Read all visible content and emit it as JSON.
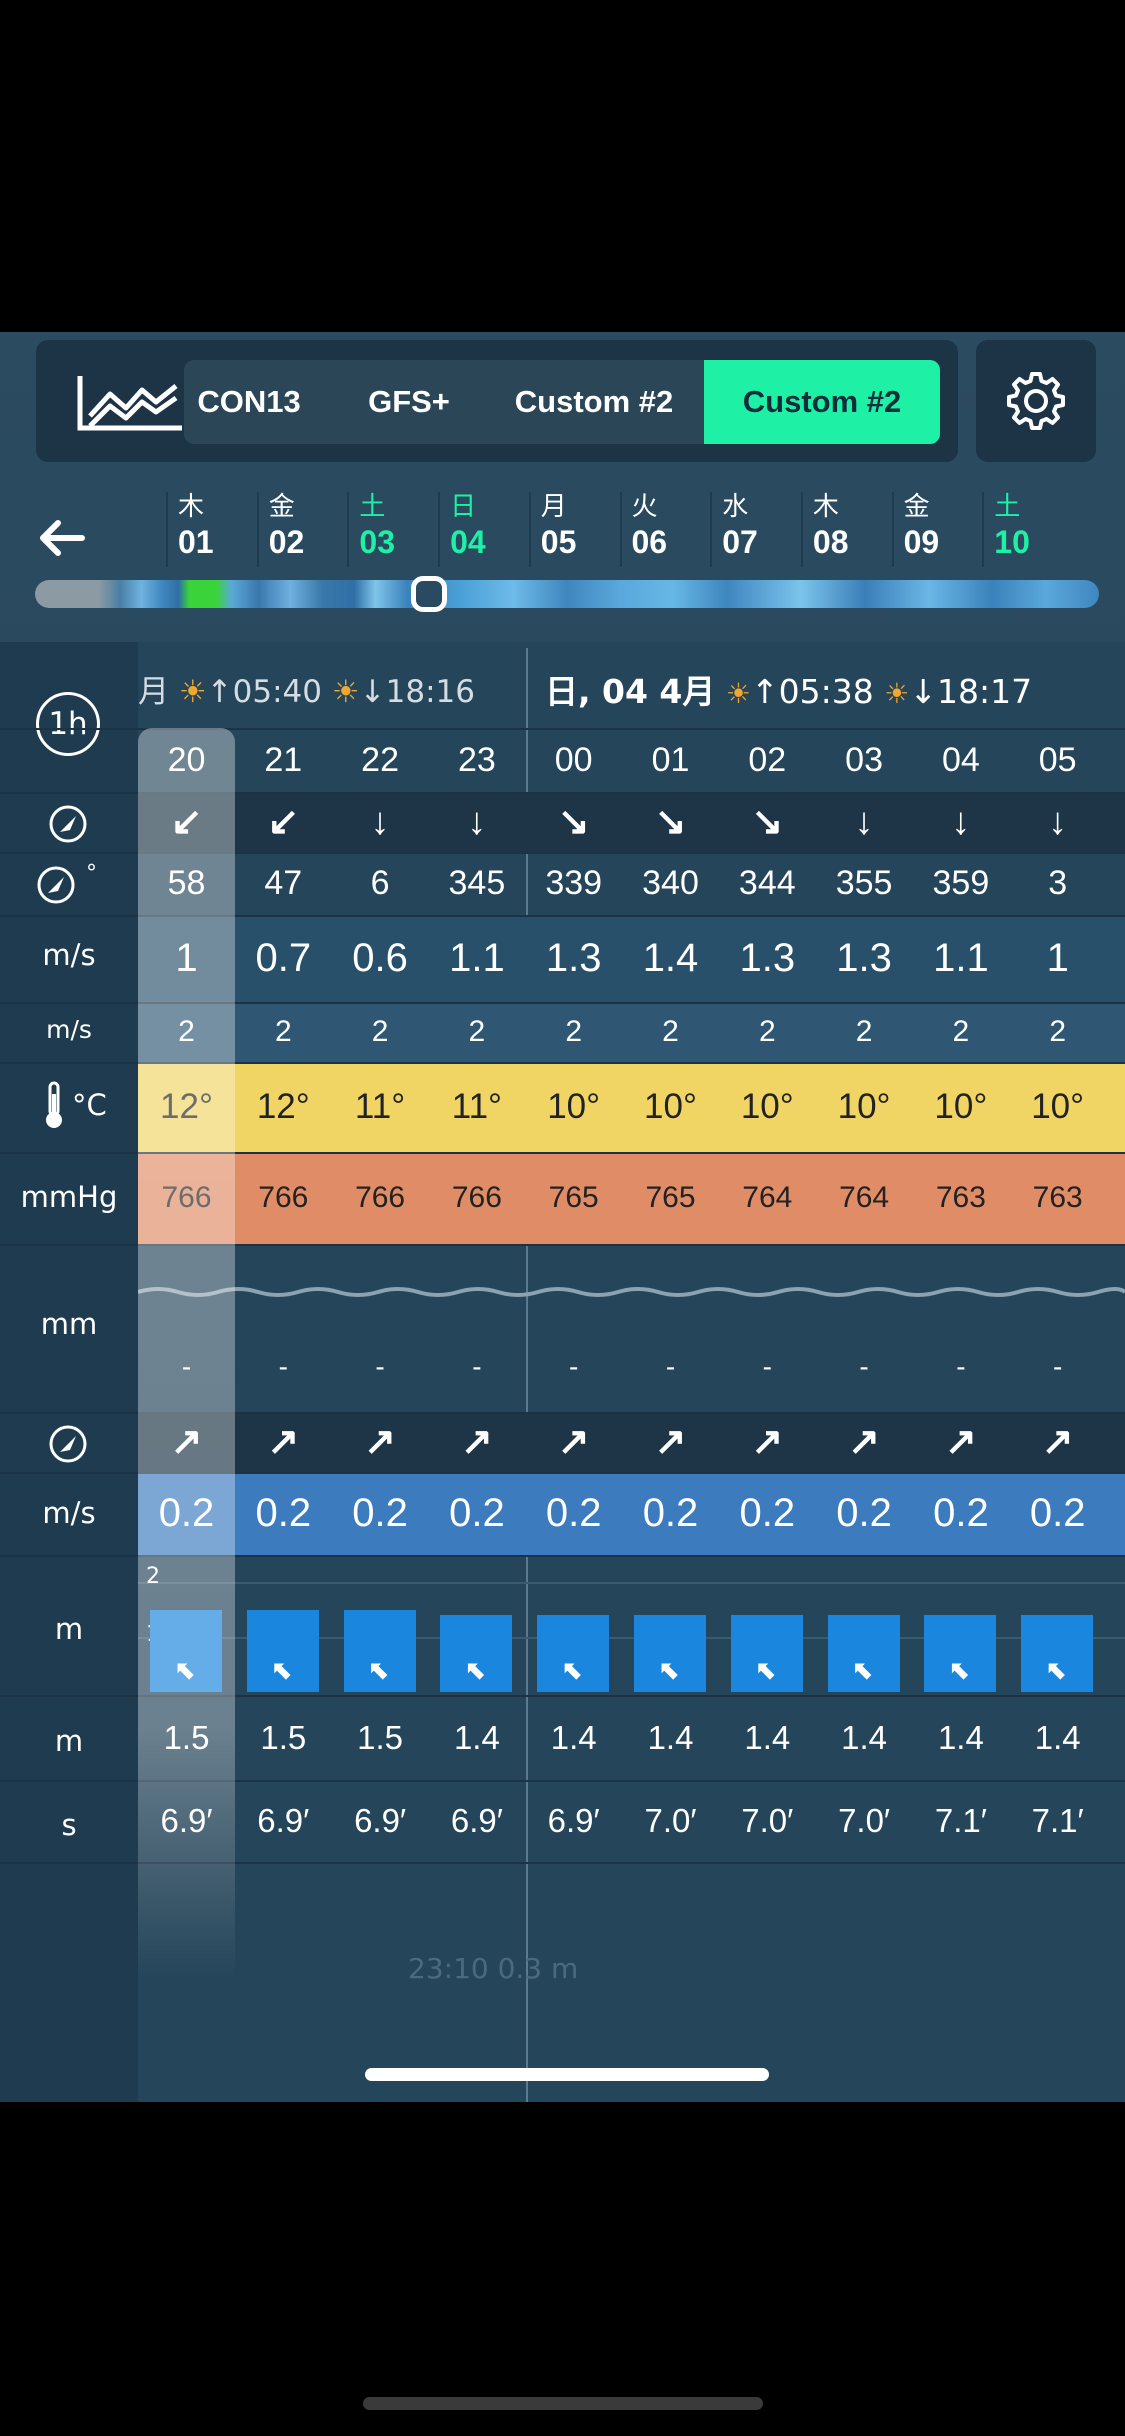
{
  "toolbar": {
    "models": [
      "CON13",
      "GFS+",
      "Custom #2",
      "Custom #2"
    ],
    "active_model_index": 3,
    "chart_icon": "line-chart-icon",
    "settings_icon": "gear-icon"
  },
  "days": [
    {
      "weekday": "木",
      "day": "01",
      "weekend": false
    },
    {
      "weekday": "金",
      "day": "02",
      "weekend": false
    },
    {
      "weekday": "土",
      "day": "03",
      "weekend": true
    },
    {
      "weekday": "日",
      "day": "04",
      "weekend": true
    },
    {
      "weekday": "月",
      "day": "05",
      "weekend": false
    },
    {
      "weekday": "火",
      "day": "06",
      "weekend": false
    },
    {
      "weekday": "水",
      "day": "07",
      "weekend": false
    },
    {
      "weekday": "木",
      "day": "08",
      "weekend": false
    },
    {
      "weekday": "金",
      "day": "09",
      "weekend": false
    },
    {
      "weekday": "土",
      "day": "10",
      "weekend": true
    }
  ],
  "interval_label": "1h",
  "day_header_left": {
    "prefix": "月",
    "sunrise": "05:40",
    "sunset": "18:16"
  },
  "day_header_right": {
    "prefix": "日, 04 4月",
    "sunrise": "05:38",
    "sunset": "18:17"
  },
  "units": {
    "wind_speed": "m/s",
    "gust": "m/s",
    "temp": "°C",
    "pressure": "mmHg",
    "rain": "mm",
    "wave_speed": "m/s",
    "wave_height": "m",
    "swell_height": "m",
    "period": "s",
    "deg": "°"
  },
  "hours": [
    "20",
    "21",
    "22",
    "23",
    "00",
    "01",
    "02",
    "03",
    "04",
    "05"
  ],
  "wind_arrows": [
    "↙",
    "↙",
    "↓",
    "↓",
    "↘",
    "↘",
    "↘",
    "↓",
    "↓",
    "↓"
  ],
  "wind_deg": [
    "58",
    "47",
    "6",
    "345",
    "339",
    "340",
    "344",
    "355",
    "359",
    "3"
  ],
  "wind_speed": [
    "1",
    "0.7",
    "0.6",
    "1.1",
    "1.3",
    "1.4",
    "1.3",
    "1.3",
    "1.1",
    "1"
  ],
  "gust": [
    "2",
    "2",
    "2",
    "2",
    "2",
    "2",
    "2",
    "2",
    "2",
    "2"
  ],
  "temp": [
    "12°",
    "12°",
    "11°",
    "11°",
    "10°",
    "10°",
    "10°",
    "10°",
    "10°",
    "10°"
  ],
  "pressure": [
    "766",
    "766",
    "766",
    "766",
    "765",
    "765",
    "764",
    "764",
    "763",
    "763"
  ],
  "rain": [
    "-",
    "-",
    "-",
    "-",
    "-",
    "-",
    "-",
    "-",
    "-",
    "-"
  ],
  "wave_arrows": [
    "↗",
    "↗",
    "↗",
    "↗",
    "↗",
    "↗",
    "↗",
    "↗",
    "↗",
    "↗"
  ],
  "wave_speed": [
    "0.2",
    "0.2",
    "0.2",
    "0.2",
    "0.2",
    "0.2",
    "0.2",
    "0.2",
    "0.2",
    "0.2"
  ],
  "wave_chart": {
    "axis_labels": [
      "2",
      "1"
    ],
    "heights": [
      1.5,
      1.5,
      1.5,
      1.4,
      1.4,
      1.4,
      1.4,
      1.4,
      1.4,
      1.4
    ]
  },
  "swell_height": [
    "1.5",
    "1.5",
    "1.5",
    "1.4",
    "1.4",
    "1.4",
    "1.4",
    "1.4",
    "1.4",
    "1.4"
  ],
  "period": [
    "6.9′",
    "6.9′",
    "6.9′",
    "6.9′",
    "6.9′",
    "7.0′",
    "7.0′",
    "7.0′",
    "7.1′",
    "7.1′"
  ],
  "tide_note": "23:10 0.3 m",
  "colors": {
    "accent": "#1ef0a5",
    "temp_bg": "#f0d565",
    "pressure_bg": "#e08c66",
    "wave_bg": "#3d7bbf",
    "bar": "#1a86dd"
  }
}
